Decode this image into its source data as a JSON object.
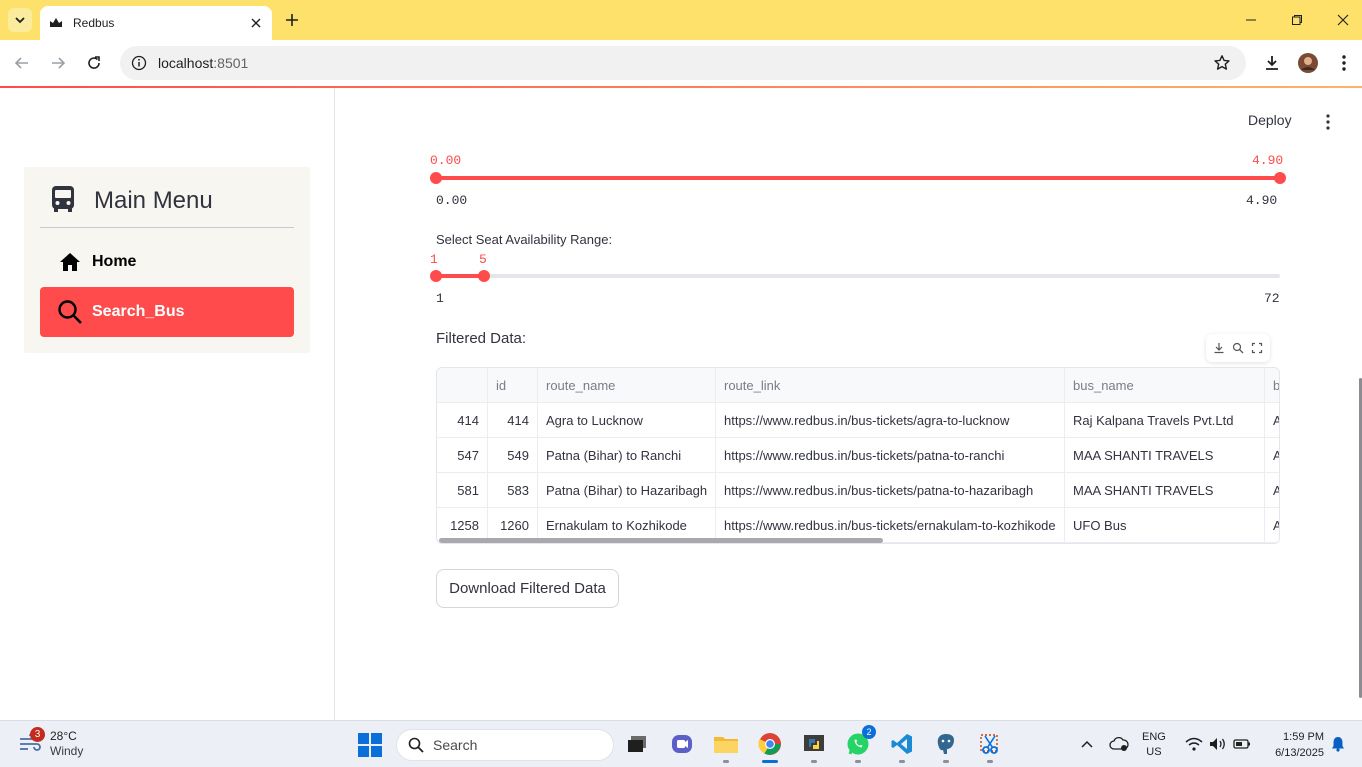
{
  "browser": {
    "tab_title": "Redbus",
    "url_host": "localhost",
    "url_port": ":8501"
  },
  "sidebar": {
    "menu_title": "Main Menu",
    "items": [
      {
        "label": "Home",
        "icon": "home-icon",
        "active": false
      },
      {
        "label": "Search_Bus",
        "icon": "search-icon",
        "active": true
      }
    ]
  },
  "main": {
    "deploy_label": "Deploy",
    "rating_slider": {
      "value_low": "0.00",
      "value_high": "4.90",
      "min_label": "0.00",
      "max_label": "4.90",
      "selected_fraction_low": 0,
      "selected_fraction_high": 1
    },
    "seat_slider": {
      "label": "Select Seat Availability Range:",
      "value_low": "1",
      "value_high": "5",
      "min_label": "1",
      "max_label": "72",
      "min": 1,
      "max": 72,
      "low": 1,
      "high": 5
    },
    "filtered_label": "Filtered Data:",
    "table": {
      "columns": [
        "",
        "id",
        "route_name",
        "route_link",
        "bus_name",
        "b"
      ],
      "rows": [
        [
          "414",
          "414",
          "Agra to Lucknow",
          "https://www.redbus.in/bus-tickets/agra-to-lucknow",
          "Raj Kalpana Travels Pvt.Ltd",
          "A"
        ],
        [
          "547",
          "549",
          "Patna (Bihar) to Ranchi",
          "https://www.redbus.in/bus-tickets/patna-to-ranchi",
          "MAA SHANTI TRAVELS",
          "A"
        ],
        [
          "581",
          "583",
          "Patna (Bihar) to Hazaribagh",
          "https://www.redbus.in/bus-tickets/patna-to-hazaribagh",
          "MAA SHANTI TRAVELS",
          "A"
        ],
        [
          "1258",
          "1260",
          "Ernakulam to Kozhikode",
          "https://www.redbus.in/bus-tickets/ernakulam-to-kozhikode",
          "UFO Bus",
          "A"
        ]
      ]
    },
    "download_button": "Download Filtered Data"
  },
  "taskbar": {
    "weather_badge": "3",
    "temperature": "28°C",
    "condition": "Windy",
    "search_placeholder": "Search",
    "whatsapp_badge": "2",
    "lang_top": "ENG",
    "lang_bottom": "US",
    "time": "1:59 PM",
    "date": "6/13/2025"
  },
  "colors": {
    "accent": "#ff4b4b",
    "titlebar": "#fde16a",
    "taskbar": "#ecf0f6"
  }
}
